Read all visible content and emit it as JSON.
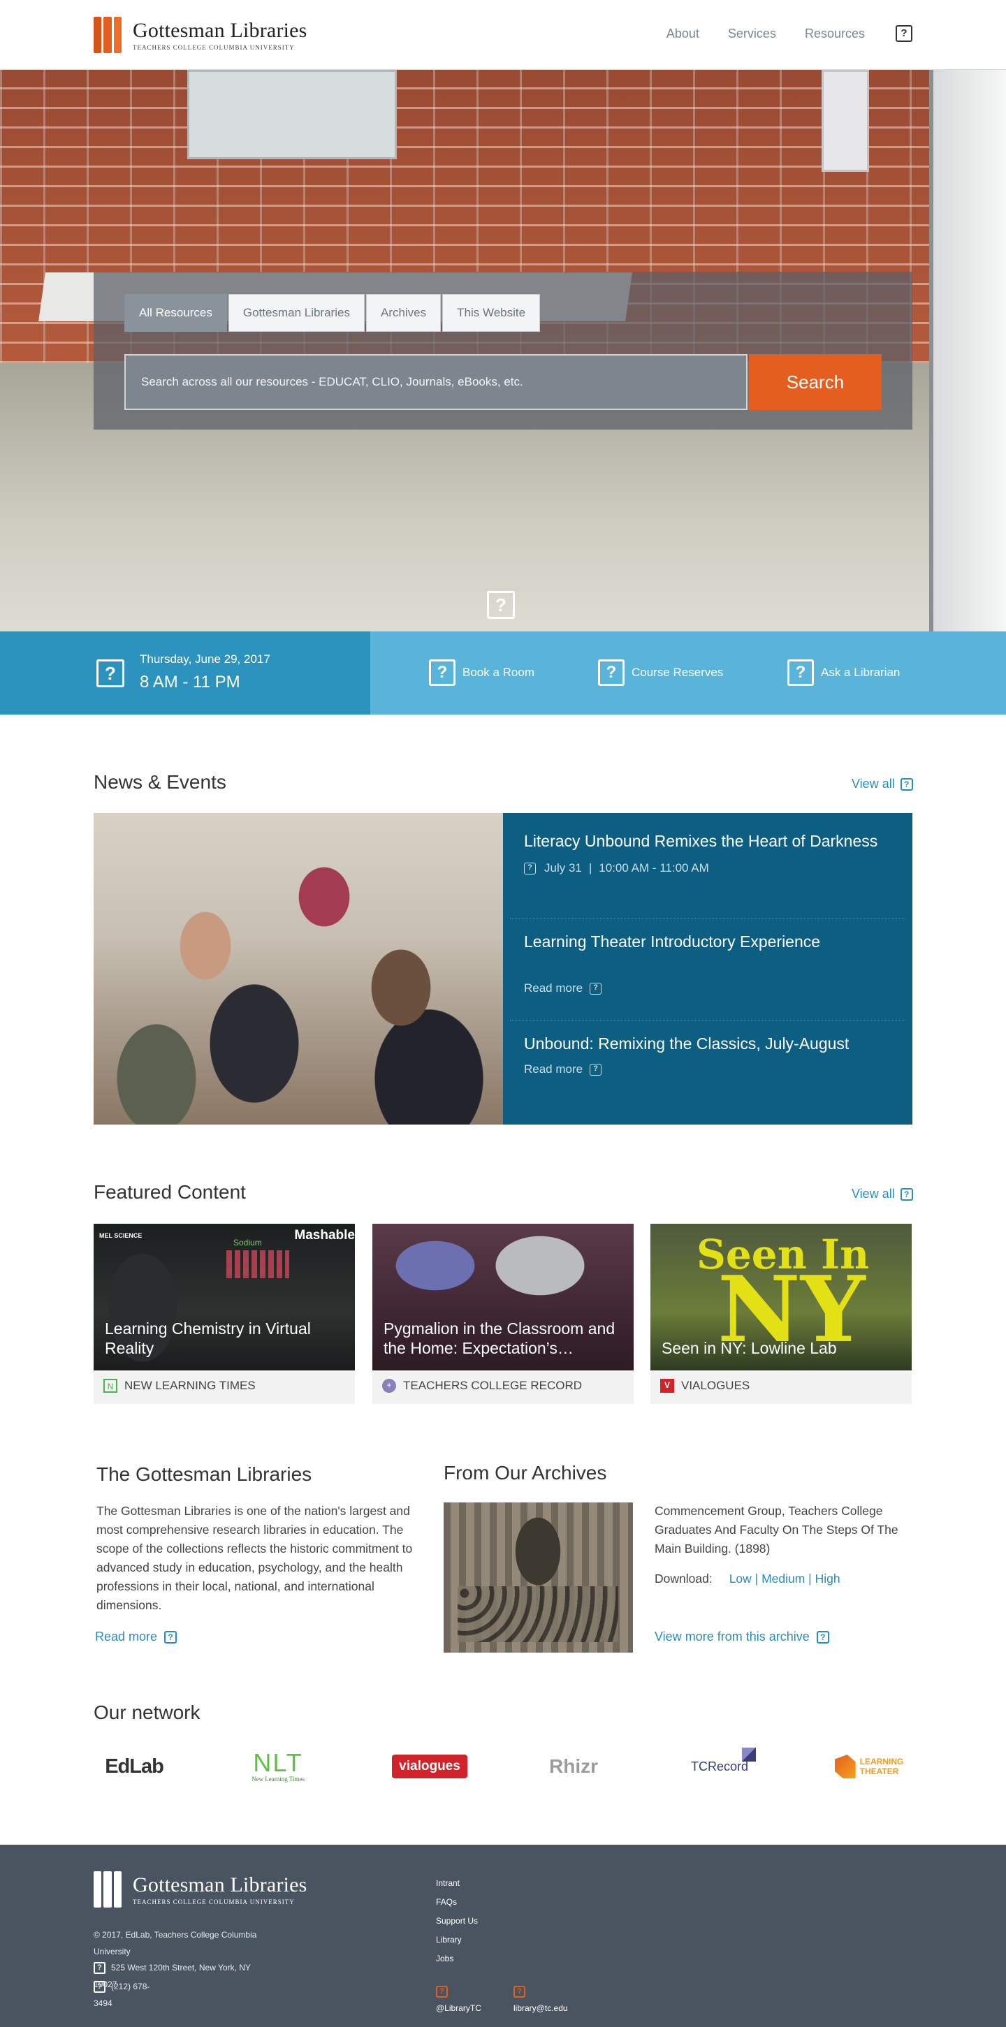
{
  "header": {
    "logo_title": "Gottesman Libraries",
    "logo_sub": "TEACHERS COLLEGE  COLUMBIA UNIVERSITY",
    "nav": [
      "About",
      "Services",
      "Resources"
    ],
    "menu_icon": "question-box-icon"
  },
  "hero": {
    "tabs": [
      "All Resources",
      "Gottesman Libraries",
      "Archives",
      "This Website"
    ],
    "active_tab": "All Resources",
    "search_placeholder": "Search across all our resources - EDUCAT, CLIO, Journals, eBooks, etc.",
    "search_button": "Search",
    "scroll_icon": "question-box-icon"
  },
  "infobar": {
    "date": "Thursday, June 29, 2017",
    "hours": "8 AM - 11 PM",
    "links": [
      "Book a Room",
      "Course Reserves",
      "Ask a Librarian"
    ]
  },
  "news": {
    "title": "News & Events",
    "view_all": "View all",
    "items": [
      {
        "title": "Literacy Unbound Remixes the Heart of Darkness",
        "date": "July 31",
        "time": "10:00 AM - 11:00 AM"
      },
      {
        "title": "Learning Theater Introductory Experience",
        "more": "Read more"
      },
      {
        "title": "Unbound: Remixing the Classics, July-August",
        "more": "Read more"
      }
    ]
  },
  "featured": {
    "title": "Featured Content",
    "view_all": "View all",
    "cards": [
      {
        "title": "Learning Chemistry in Virtual Reality",
        "source": "NEW LEARNING TIMES",
        "img_text_1": "MEL SCIENCE",
        "img_text_2": "Mashable",
        "img_text_3": "Sodium"
      },
      {
        "title": "Pygmalion in the Classroom and the Home: Expectation’s…",
        "source": "TEACHERS COLLEGE RECORD"
      },
      {
        "title": "Seen in NY: Lowline Lab",
        "source": "VIALOGUES",
        "img_text_1": "Seen In",
        "img_text_2": "NY"
      }
    ],
    "colors": {
      "nlt": "#4caf50",
      "tcr": "#8a7fb8",
      "vialogues": "#d0232a"
    }
  },
  "about": {
    "title": "The Gottesman Libraries",
    "text": "The Gottesman Libraries is one of the nation's largest and most comprehensive research libraries in education. The scope of the collections reflects the historic commitment to advanced study in education, psychology, and the health professions in their local, national, and international dimensions.",
    "read_more": "Read more"
  },
  "archives": {
    "title": "From Our Archives",
    "caption": "Commencement Group, Teachers College Graduates And Faculty On The Steps Of The Main Building. (1898)",
    "download_label": "Download:",
    "download_links": "Low | Medium | High",
    "view_more": "View more from this archive"
  },
  "network": {
    "title": "Our network",
    "logos": {
      "edlab": "EdLab",
      "nlt": "NLT",
      "nlt_sub": "New Learning Times",
      "vialogues": "vialogues",
      "rhizr": "Rhizr",
      "tcrecord": "TCRecord",
      "lt1": "LEARNING",
      "lt2": "THEATER"
    }
  },
  "footer": {
    "copyright": "© 2017, EdLab, Teachers College Columbia University",
    "address": "525 West 120th Street, New York, NY 10027",
    "phone": "(212) 678-3494",
    "links": [
      "Intrant",
      "FAQs",
      "Support Us",
      "Library",
      "Jobs"
    ],
    "twitter": "@LibraryTC",
    "email": "library@tc.edu"
  },
  "colors": {
    "brand_orange": "#e35e1f",
    "link_blue": "#2a8bbd",
    "news_bg": "#0c5f82",
    "info_dark": "#2c93bf",
    "info_light": "#5ab4d9",
    "footer_bg": "#4a5461"
  }
}
